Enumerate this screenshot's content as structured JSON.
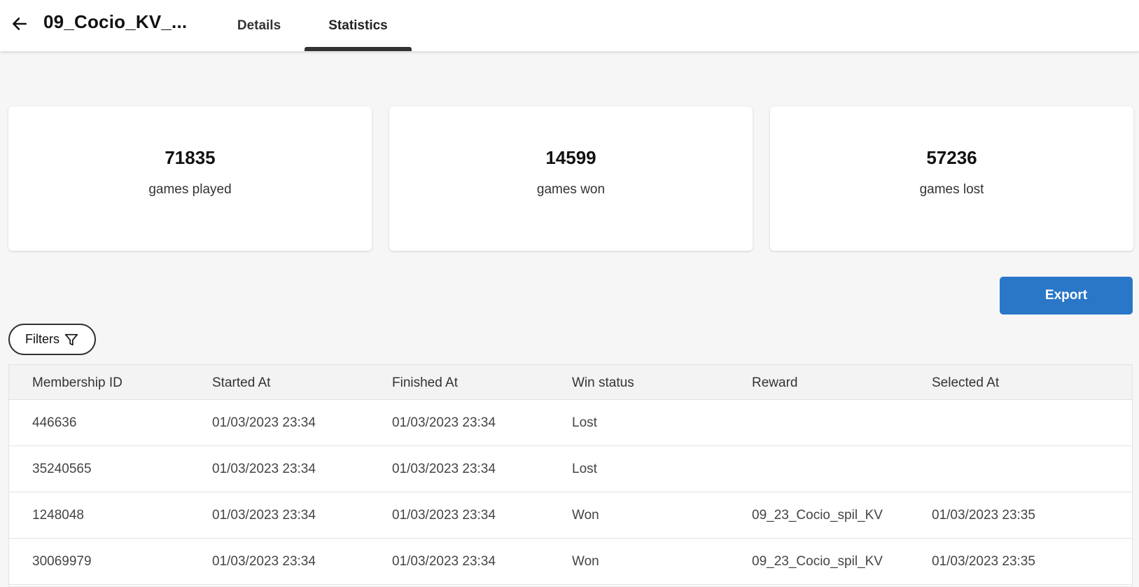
{
  "header": {
    "title": "09_Cocio_KV_...",
    "tabs": [
      {
        "label": "Details"
      },
      {
        "label": "Statistics"
      }
    ],
    "active_tab": "Statistics"
  },
  "stats": [
    {
      "value": "71835",
      "label": "games played"
    },
    {
      "value": "14599",
      "label": "games won"
    },
    {
      "value": "57236",
      "label": "games lost"
    }
  ],
  "actions": {
    "export_label": "Export",
    "filters_label": "Filters"
  },
  "table": {
    "columns": [
      "Membership ID",
      "Started At",
      "Finished At",
      "Win status",
      "Reward",
      "Selected At"
    ],
    "rows": [
      {
        "membership_id": "446636",
        "started_at": "01/03/2023 23:34",
        "finished_at": "01/03/2023 23:34",
        "win_status": "Lost",
        "reward": "",
        "selected_at": ""
      },
      {
        "membership_id": "35240565",
        "started_at": "01/03/2023 23:34",
        "finished_at": "01/03/2023 23:34",
        "win_status": "Lost",
        "reward": "",
        "selected_at": ""
      },
      {
        "membership_id": "1248048",
        "started_at": "01/03/2023 23:34",
        "finished_at": "01/03/2023 23:34",
        "win_status": "Won",
        "reward": "09_23_Cocio_spil_KV",
        "selected_at": "01/03/2023 23:35"
      },
      {
        "membership_id": "30069979",
        "started_at": "01/03/2023 23:34",
        "finished_at": "01/03/2023 23:34",
        "win_status": "Won",
        "reward": "09_23_Cocio_spil_KV",
        "selected_at": "01/03/2023 23:35"
      }
    ]
  },
  "colors": {
    "accent": "#2a77c8",
    "background": "#f6f6f6",
    "card": "#ffffff"
  },
  "icons": {
    "back": "arrow-left-icon",
    "filter": "funnel-icon"
  }
}
